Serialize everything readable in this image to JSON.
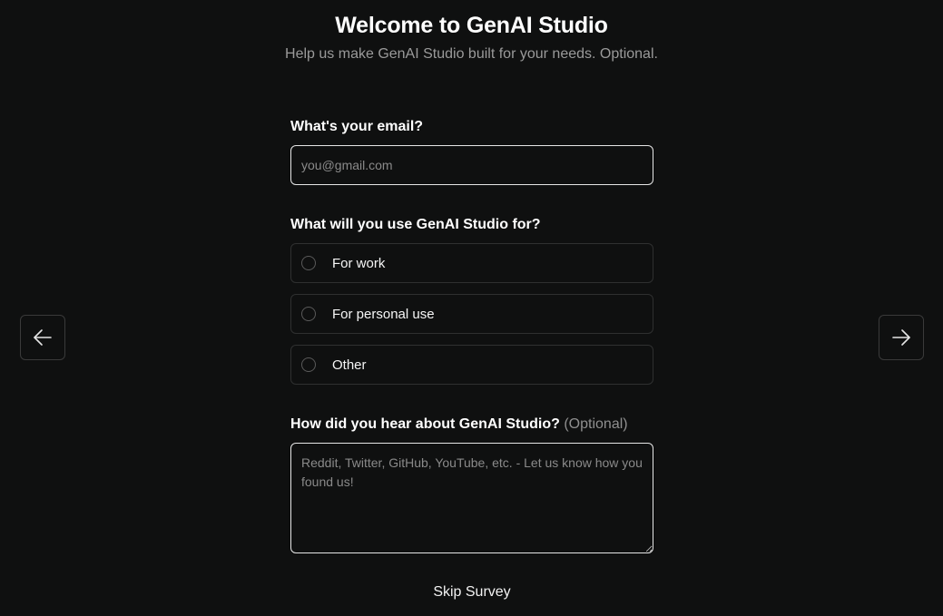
{
  "header": {
    "title": "Welcome to GenAI Studio",
    "subtitle": "Help us make GenAI Studio built for your needs. Optional."
  },
  "email": {
    "label": "What's your email?",
    "placeholder": "you@gmail.com",
    "value": ""
  },
  "usage": {
    "label": "What will you use GenAI Studio for?",
    "options": [
      {
        "label": "For work",
        "selected": false
      },
      {
        "label": "For personal use",
        "selected": false
      },
      {
        "label": "Other",
        "selected": false
      }
    ]
  },
  "referral": {
    "label": "How did you hear about GenAI Studio?",
    "optional_tag": "(Optional)",
    "placeholder": "Reddit, Twitter, GitHub, YouTube, etc. - Let us know how you found us!",
    "value": ""
  },
  "actions": {
    "skip_label": "Skip Survey"
  },
  "navigation": {
    "prev_icon": "arrow-left-icon",
    "next_icon": "arrow-right-icon"
  },
  "colors": {
    "background": "#0f1010",
    "input_border": "#e6e6e6",
    "option_border": "#2f3030",
    "muted_text": "#9a9a9a"
  }
}
